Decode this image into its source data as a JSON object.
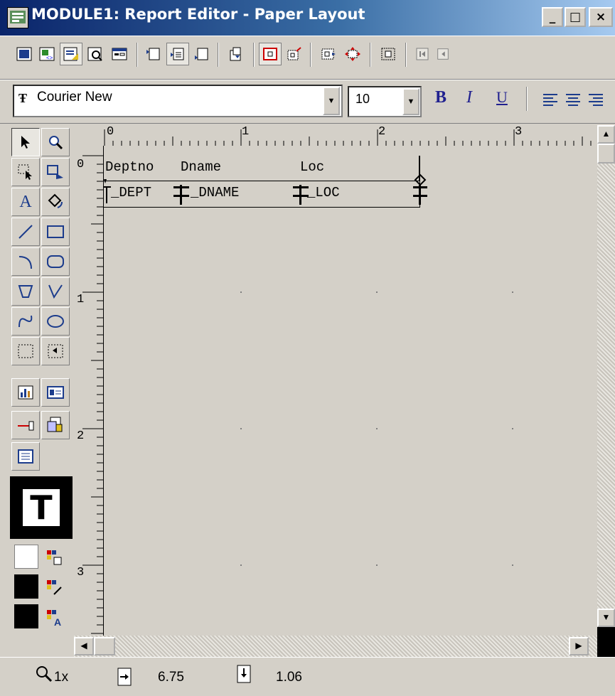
{
  "window": {
    "title": "MODULE1: Report Editor - Paper Layout",
    "minimize": "_",
    "maximize": "□",
    "close": "×"
  },
  "toolbar": {
    "icons": [
      "data-model-icon",
      "data-wizard-icon",
      "layout-model-icon",
      "live-previewer-icon",
      "parameter-form-icon",
      "header-section-icon",
      "main-section-icon",
      "trailer-section-icon",
      "insert-field-icon",
      "confine-mode-icon",
      "flex-mode-icon",
      "align-objects-icon",
      "size-objects-icon",
      "select-parent-icon",
      "first-page-icon",
      "previous-page-icon"
    ]
  },
  "font_bar": {
    "font_name": "Courier New",
    "font_size": "10",
    "bold": "B",
    "italic": "I",
    "underline": "U"
  },
  "palette": {
    "tools": [
      "select-tool",
      "magnify-tool",
      "frame-select-tool",
      "reshape-tool",
      "text-tool",
      "rotate-tool",
      "line-tool",
      "rectangle-tool",
      "arc-tool",
      "rounded-rectangle-tool",
      "polygon-tool",
      "polyline-tool",
      "freehand-tool",
      "ellipse-tool",
      "frame-tool",
      "repeating-frame-tool",
      "graph-tool",
      "field-tool",
      "link-file-tool",
      "ole-tool",
      "button-tool"
    ],
    "preview_letter": "T"
  },
  "ruler": {
    "h_labels": [
      "0",
      "1",
      "2",
      "3"
    ],
    "v_labels": [
      "0",
      "1",
      "2",
      "3"
    ]
  },
  "layout": {
    "labels": [
      "Deptno",
      "Dname",
      "Loc"
    ],
    "fields": [
      "F_DEPTNO",
      "F_DNAME",
      "F_LOC"
    ],
    "fields_display": [
      "_DEPT",
      "_DNAME",
      "_LOC"
    ]
  },
  "status": {
    "zoom": "1x",
    "x_pos": "6.75",
    "y_pos": "1.06"
  }
}
